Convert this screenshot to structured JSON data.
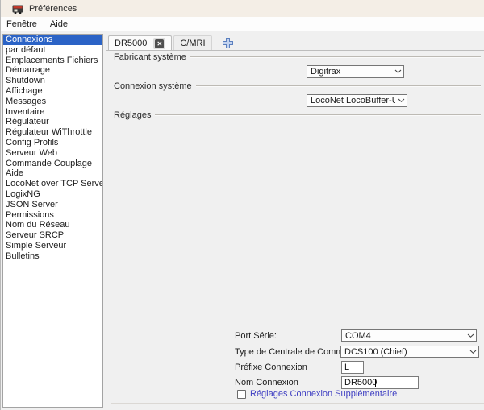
{
  "window": {
    "title": "Préférences"
  },
  "menu": {
    "items": [
      "Fenêtre",
      "Aide"
    ]
  },
  "sidebar": {
    "items": [
      {
        "label": "Connexions",
        "selected": true
      },
      {
        "label": "par défaut"
      },
      {
        "label": "Emplacements Fichiers"
      },
      {
        "label": "Démarrage"
      },
      {
        "label": "Shutdown"
      },
      {
        "label": "Affichage"
      },
      {
        "label": "Messages"
      },
      {
        "label": "Inventaire"
      },
      {
        "label": "Régulateur"
      },
      {
        "label": "Régulateur WiThrottle"
      },
      {
        "label": "Config Profils"
      },
      {
        "label": "Serveur Web"
      },
      {
        "label": "Commande Couplage"
      },
      {
        "label": "Aide"
      },
      {
        "label": "LocoNet over TCP Server"
      },
      {
        "label": "LogixNG"
      },
      {
        "label": "JSON Server"
      },
      {
        "label": "Permissions"
      },
      {
        "label": "Nom du Réseau"
      },
      {
        "label": "Serveur SRCP"
      },
      {
        "label": "Simple Serveur"
      },
      {
        "label": "Bulletins"
      }
    ]
  },
  "tabs": {
    "active": "DR5000",
    "close_glyph": "✕",
    "inactive": "C/MRI"
  },
  "sections": {
    "manufacturer": "Fabricant système",
    "connection": "Connexion système",
    "settings": "Réglages"
  },
  "fields": {
    "manufacturer_value": "Digitrax",
    "connection_value": "LocoNet LocoBuffer-USB",
    "serial_port_label": "Port Série:",
    "serial_port_value": "COM4",
    "command_station_label": "Type de Centrale de Commande:",
    "command_station_value": "DCS100 (Chief)",
    "prefix_label": "Préfixe Connexion",
    "prefix_value": "L",
    "name_label": "Nom Connexion",
    "name_value": "DR5000",
    "additional_checkbox_label": "Réglages Connexion Supplémentaire"
  },
  "colors": {
    "selection_blue": "#2b63c6",
    "checkbox_label_blue": "#3e3ec2",
    "titlebar_beige": "#f4eee6"
  }
}
